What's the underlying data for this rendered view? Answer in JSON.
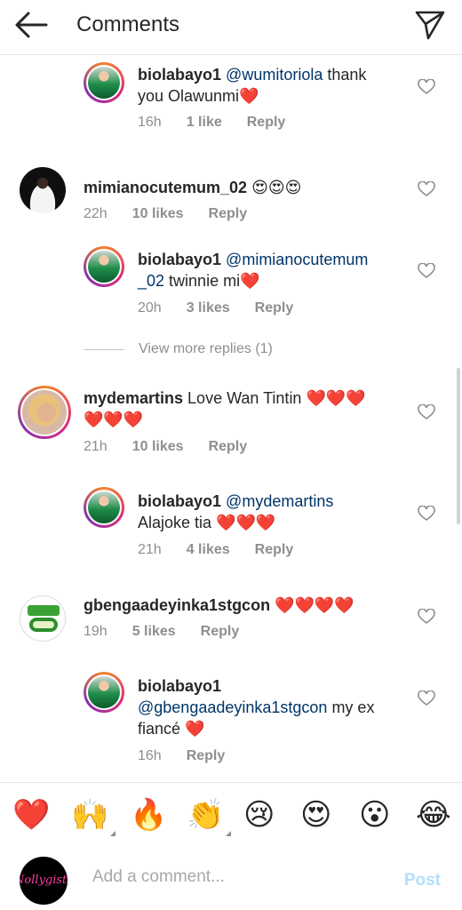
{
  "header": {
    "title": "Comments"
  },
  "comments": [
    {
      "user": "biolabayo1",
      "mention": "@wumitoriola",
      "text": " thank",
      "text2": "you Olawunmi",
      "hearts": "❤️",
      "time": "16h",
      "likes": "1 like",
      "reply": "Reply"
    },
    {
      "user": "mimianocutemum_02",
      "text": "",
      "hearts": "😍😍😍",
      "time": "22h",
      "likes": "10 likes",
      "reply": "Reply"
    },
    {
      "user": "biolabayo1",
      "mention": "@mimianocutemum",
      "mention2": "_02",
      "text": " twinnie mi",
      "hearts": "❤️",
      "time": "20h",
      "likes": "3 likes",
      "reply": "Reply"
    },
    {
      "user": "mydemartins",
      "text": " Love Wan Tintin ",
      "hearts": "❤️❤️❤️",
      "hearts2": "❤️❤️❤️",
      "time": "21h",
      "likes": "10 likes",
      "reply": "Reply"
    },
    {
      "user": "biolabayo1",
      "mention": "@mydemartins",
      "text": "Alajoke tia ",
      "hearts": "❤️❤️❤️",
      "time": "21h",
      "likes": "4 likes",
      "reply": "Reply"
    },
    {
      "user": "gbengaadeyinka1stgcon",
      "hearts": "❤️❤️❤️❤️",
      "time": "19h",
      "likes": "5 likes",
      "reply": "Reply"
    },
    {
      "user": "biolabayo1",
      "mention": "@gbengaadeyinka1stgcon",
      "text": " my ex",
      "text2": "fiancé ",
      "hearts": "❤️",
      "time": "16h",
      "reply": "Reply"
    }
  ],
  "view_more": "View more replies (1)",
  "emoji_bar": [
    "❤️",
    "🙌",
    "🔥",
    "👏",
    "😢",
    "😍",
    "😮",
    "😂"
  ],
  "composer": {
    "placeholder": "Add a comment...",
    "post": "Post",
    "avatar_text": "Nollygists"
  },
  "colors": {
    "mention": "#003569",
    "post_disabled": "#b2dffc",
    "meta": "#8e8e8e"
  }
}
